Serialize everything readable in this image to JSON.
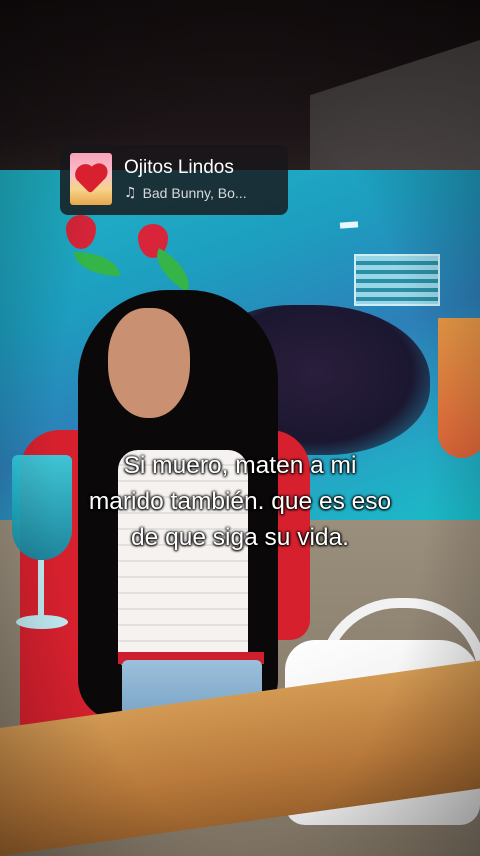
{
  "now_playing": {
    "title": "Ojitos Lindos",
    "artist": "Bad Bunny, Bo...",
    "note_icon": "music-note-icon"
  },
  "caption": {
    "lines": [
      "Si muero, maten a mi",
      "marido también. que es eso",
      "de que siga su vida."
    ]
  },
  "colors": {
    "pill_background": "#18161a",
    "caption_text": "#ffffff"
  }
}
